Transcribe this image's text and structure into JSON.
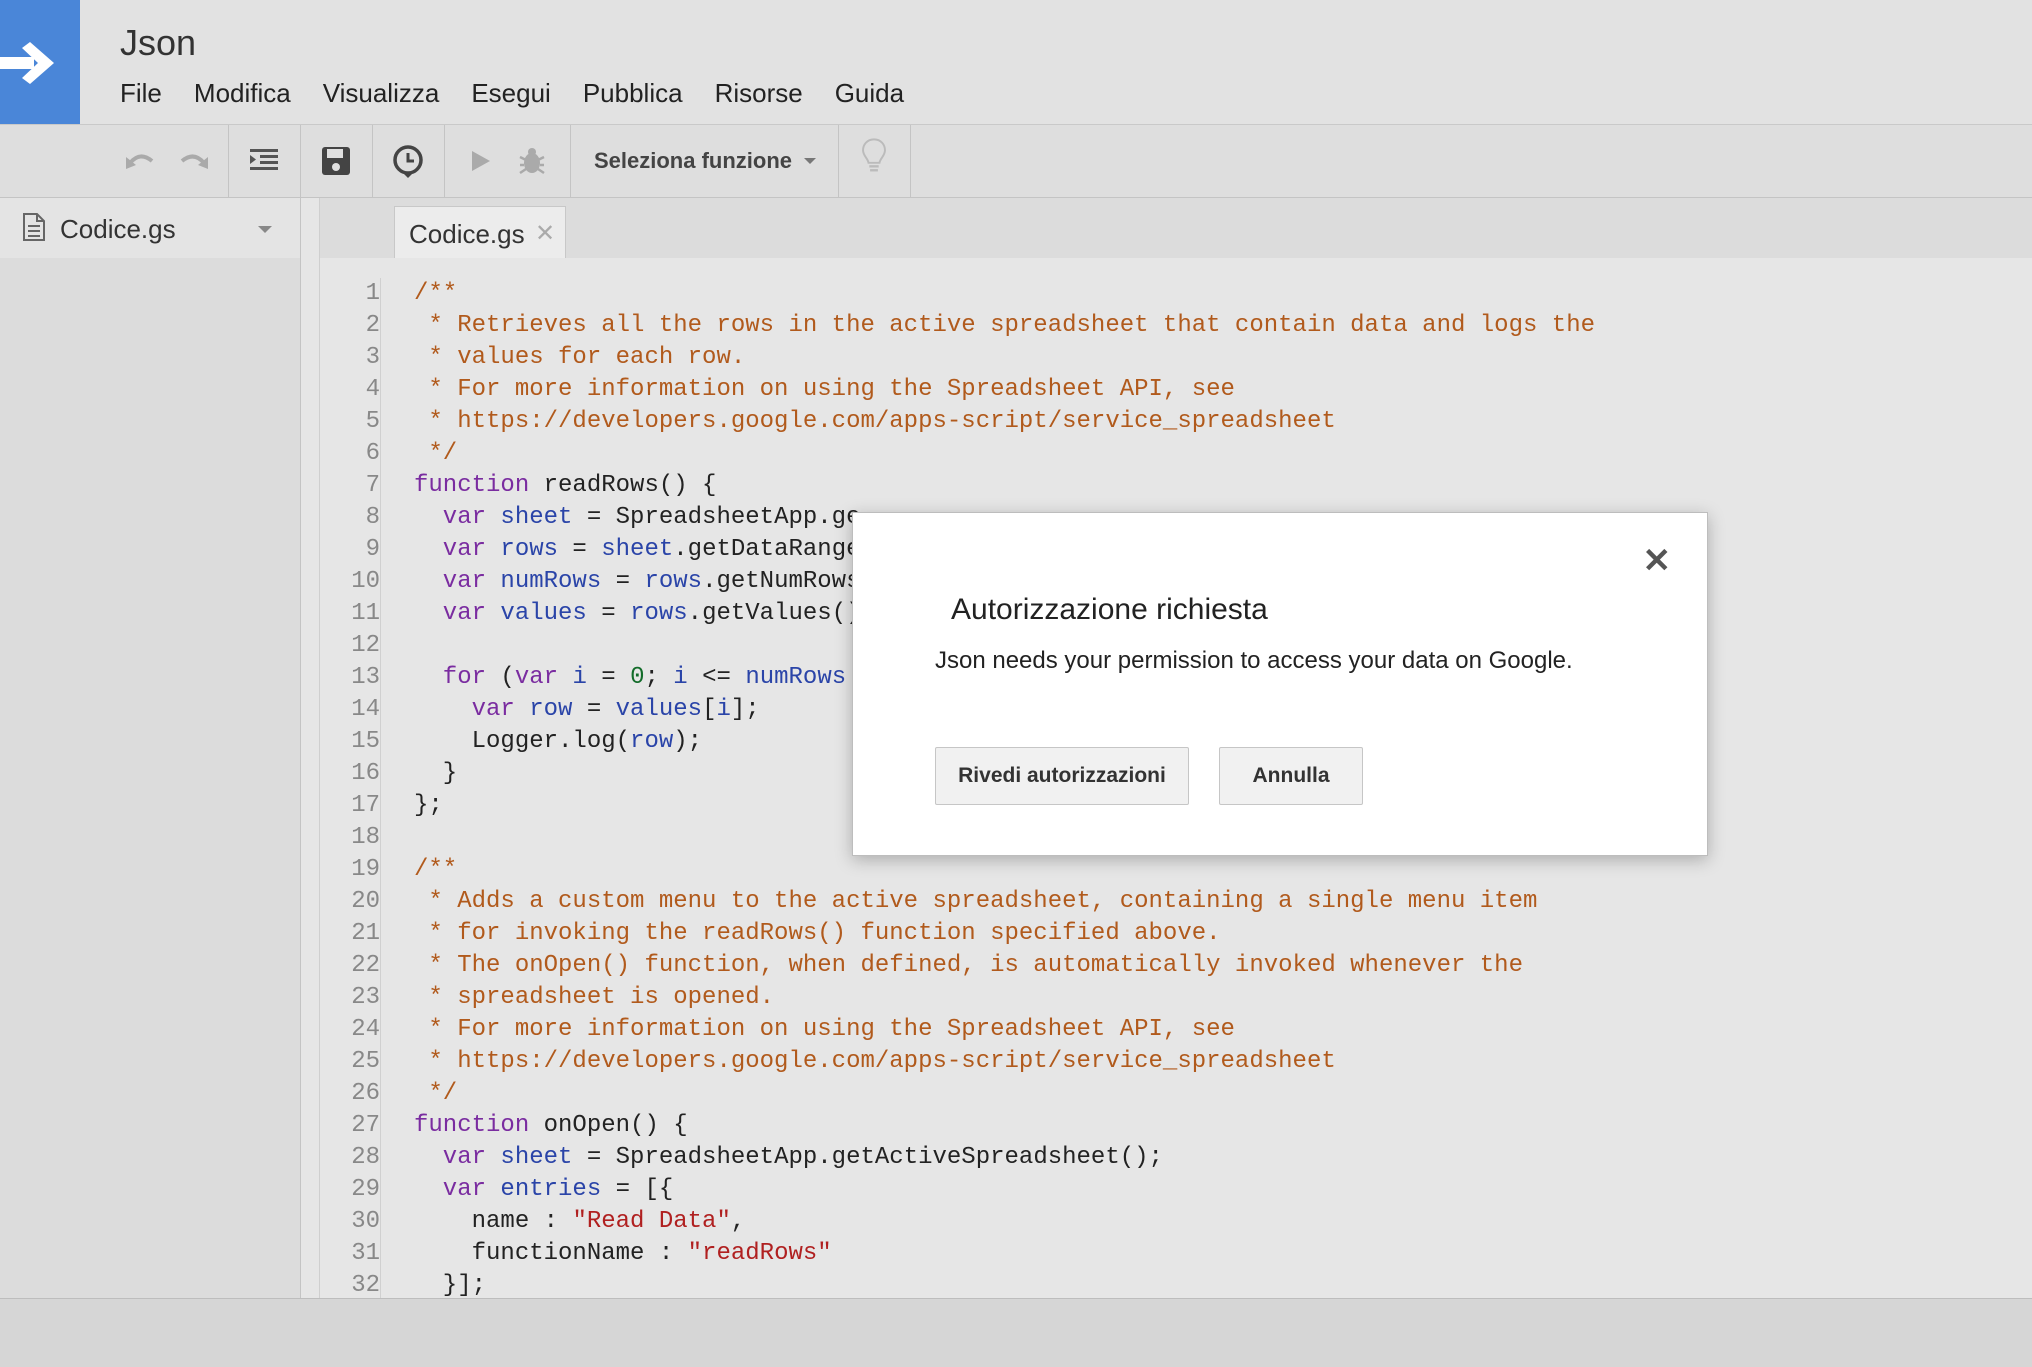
{
  "app": {
    "title": "Json",
    "menu": [
      "File",
      "Modifica",
      "Visualizza",
      "Esegui",
      "Pubblica",
      "Risorse",
      "Guida"
    ]
  },
  "toolbar": {
    "function_select": "Seleziona funzione"
  },
  "sidebar": {
    "file_name": "Codice.gs"
  },
  "editor": {
    "tab_label": "Codice.gs",
    "line_numbers": [
      "1",
      "2",
      "3",
      "4",
      "5",
      "6",
      "7",
      "8",
      "9",
      "10",
      "11",
      "12",
      "13",
      "14",
      "15",
      "16",
      "17",
      "18",
      "19",
      "20",
      "21",
      "22",
      "23",
      "24",
      "25",
      "26",
      "27",
      "28",
      "29",
      "30",
      "31",
      "32"
    ]
  },
  "dialog": {
    "title": "Autorizzazione richiesta",
    "message": "Json needs your permission to access your data on Google.",
    "review_button": "Rivedi autorizzazioni",
    "cancel_button": "Annulla",
    "close_label": "✕"
  },
  "code": {
    "l1": "/**",
    "l2": " * Retrieves all the rows in the active spreadsheet that contain data and logs the",
    "l3": " * values for each row.",
    "l4": " * For more information on using the Spreadsheet API, see",
    "l5": " * https://developers.google.com/apps-script/service_spreadsheet",
    "l6": " */",
    "l7_kw": "function",
    "l7_rest": " readRows() {",
    "l8_kw": "  var",
    "l8_var": " sheet",
    "l8_rest": " = SpreadsheetApp.ge",
    "l9_kw": "  var",
    "l9_var": " rows",
    "l9_mid": " = ",
    "l9_var2": "sheet",
    "l9_rest": ".getDataRange",
    "l10_kw": "  var",
    "l10_var": " numRows",
    "l10_mid": " = ",
    "l10_var2": "rows",
    "l10_rest": ".getNumRows",
    "l11_kw": "  var",
    "l11_var": " values",
    "l11_mid": " = ",
    "l11_var2": "rows",
    "l11_rest": ".getValues()",
    "l13_kw": "  for",
    "l13_a": " (",
    "l13_kw2": "var",
    "l13_var": " i",
    "l13_b": " = ",
    "l13_num": "0",
    "l13_c": "; ",
    "l13_var2": "i",
    "l13_d": " <= ",
    "l13_var3": "numRows",
    "l14_kw": "    var",
    "l14_var": " row",
    "l14_mid": " = ",
    "l14_var2": "values",
    "l14_b": "[",
    "l14_var3": "i",
    "l14_rest": "];",
    "l15_a": "    Logger.log(",
    "l15_var": "row",
    "l15_rest": ");",
    "l16": "  }",
    "l17": "};",
    "l19": "/**",
    "l20": " * Adds a custom menu to the active spreadsheet, containing a single menu item",
    "l21": " * for invoking the readRows() function specified above.",
    "l22": " * The onOpen() function, when defined, is automatically invoked whenever the",
    "l23": " * spreadsheet is opened.",
    "l24": " * For more information on using the Spreadsheet API, see",
    "l25": " * https://developers.google.com/apps-script/service_spreadsheet",
    "l26": " */",
    "l27_kw": "function",
    "l27_rest": " onOpen() {",
    "l28_kw": "  var",
    "l28_var": " sheet",
    "l28_rest": " = SpreadsheetApp.getActiveSpreadsheet();",
    "l29_kw": "  var",
    "l29_var": " entries",
    "l29_rest": " = [{",
    "l30_a": "    name : ",
    "l30_str": "\"Read Data\"",
    "l30_rest": ",",
    "l31_a": "    functionName : ",
    "l31_str": "\"readRows\"",
    "l32": "  }];"
  }
}
